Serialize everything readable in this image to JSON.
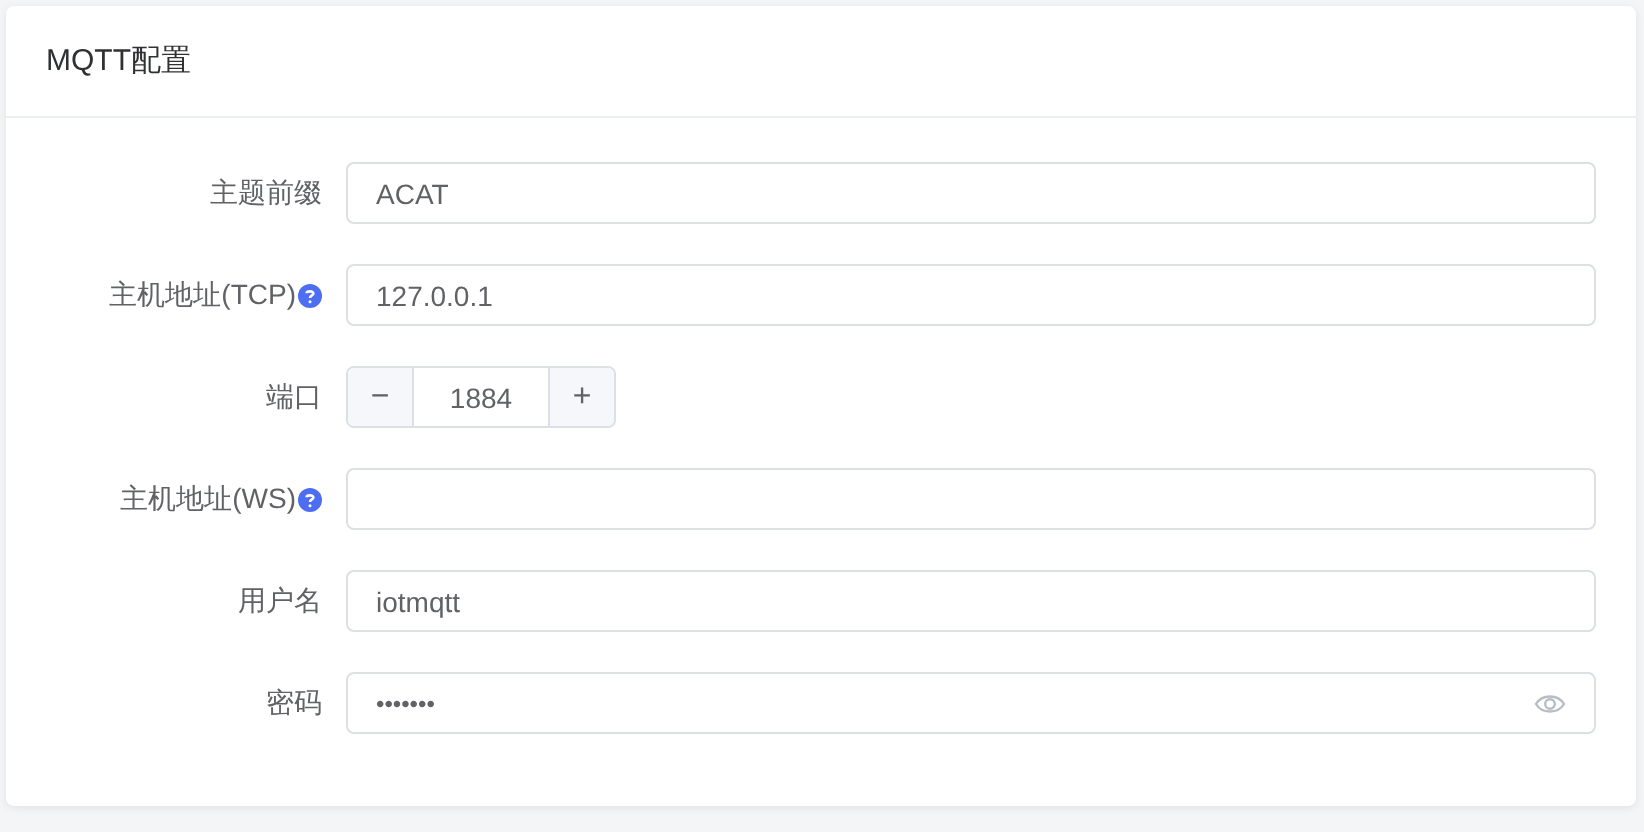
{
  "card": {
    "title": "MQTT配置"
  },
  "fields": [
    {
      "kind": "text",
      "label": "主题前缀",
      "help": false,
      "value": "ACAT"
    },
    {
      "kind": "text",
      "label": "主机地址(TCP)",
      "help": true,
      "value": "127.0.0.1"
    },
    {
      "kind": "number",
      "label": "端口",
      "help": false,
      "value": "1884",
      "minus": "−",
      "plus": "+"
    },
    {
      "kind": "text",
      "label": "主机地址(WS)",
      "help": true
    },
    {
      "kind": "text",
      "label": "用户名",
      "help": false,
      "value": "iotmqtt"
    },
    {
      "kind": "password",
      "label": "密码",
      "help": false,
      "value": "•••••••"
    }
  ]
}
